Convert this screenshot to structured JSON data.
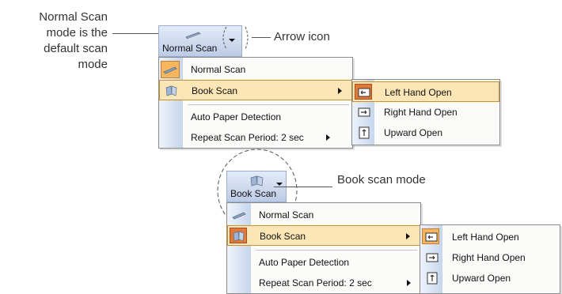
{
  "callouts": {
    "normal_mode": [
      "Normal Scan",
      "mode is the",
      "default scan",
      "mode"
    ],
    "arrow_icon": "Arrow icon",
    "book_mode": "Book scan mode"
  },
  "top": {
    "button_label": "Normal Scan",
    "menu": [
      {
        "label": "Normal Scan",
        "icon": "scanner-icon"
      },
      {
        "label": "Book Scan",
        "icon": "book-icon",
        "submenu": true
      },
      {
        "label": "Auto Paper Detection"
      },
      {
        "label": "Repeat Scan Period:  2 sec",
        "submenu": true
      }
    ],
    "submenu": [
      {
        "label": "Left Hand Open",
        "icon": "left-hand-open-icon"
      },
      {
        "label": "Right Hand Open",
        "icon": "right-hand-open-icon"
      },
      {
        "label": "Upward Open",
        "icon": "upward-open-icon"
      }
    ]
  },
  "bottom": {
    "button_label": "Book Scan",
    "menu": [
      {
        "label": "Normal Scan",
        "icon": "scanner-icon"
      },
      {
        "label": "Book Scan",
        "icon": "book-icon",
        "submenu": true
      },
      {
        "label": "Auto Paper Detection"
      },
      {
        "label": "Repeat Scan Period:  2 sec",
        "submenu": true
      }
    ],
    "submenu": [
      {
        "label": "Left Hand Open",
        "icon": "left-hand-open-icon"
      },
      {
        "label": "Right Hand Open",
        "icon": "right-hand-open-icon"
      },
      {
        "label": "Upward Open",
        "icon": "upward-open-icon"
      }
    ]
  }
}
